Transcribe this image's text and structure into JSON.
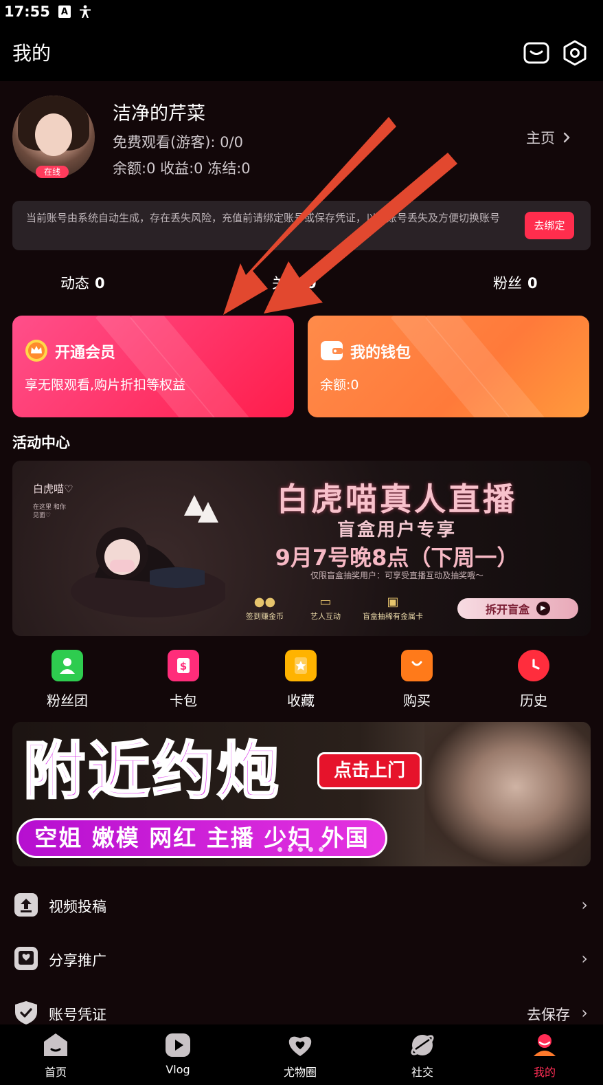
{
  "status_bar": {
    "time": "17:55",
    "icons": [
      "a-box-icon",
      "accessibility-icon"
    ]
  },
  "header": {
    "title": "我的",
    "icons": [
      "message-icon",
      "settings-icon"
    ]
  },
  "profile": {
    "online_badge": "在线",
    "nickname": "洁净的芹菜",
    "free_watch": "免费观看(游客): 0/0",
    "balances": "余额:0 收益:0 冻结:0",
    "homepage_link": "主页"
  },
  "notice": {
    "text": "当前账号由系统自动生成，存在丢失风险，充值前请绑定账号或保存凭证，以防账号丢失及方便切换账号",
    "button": "去绑定"
  },
  "stats": [
    {
      "label": "动态",
      "value": "0"
    },
    {
      "label": "关注",
      "value": "0"
    },
    {
      "label": "粉丝",
      "value": "0"
    }
  ],
  "cards": {
    "vip": {
      "title": "开通会员",
      "subtitle": "享无限观看,购片折扣等权益"
    },
    "wallet": {
      "title": "我的钱包",
      "subtitle": "余额:0"
    }
  },
  "section_title": "活动中心",
  "event_banner": {
    "corner_text": "白虎喵♡",
    "corner_sub": "在这里 和你见面♡",
    "title": "白虎喵真人直播",
    "subtitle": "盲盒用户专享",
    "date": "9月7号晚8点（下周一）",
    "note": "仅限盲盒抽奖用户：可享受直播互动及抽奖哦～",
    "features": [
      "签到赚金币",
      "艺人互动",
      "盲盒抽稀有金属卡"
    ],
    "button": "拆开盲盒"
  },
  "quick_menu": [
    {
      "label": "粉丝团",
      "icon": "fan-club-icon",
      "color": "#2ecc4f"
    },
    {
      "label": "卡包",
      "icon": "card-wallet-icon",
      "color": "#ff2d7a"
    },
    {
      "label": "收藏",
      "icon": "favorite-icon",
      "color": "#ffb300"
    },
    {
      "label": "购买",
      "icon": "purchase-icon",
      "color": "#ff7a1a"
    },
    {
      "label": "历史",
      "icon": "history-icon",
      "color": "#ff2d3d"
    }
  ],
  "ad_banner": {
    "headline": "附近约炮",
    "cta": "点击上门",
    "strip": "空姐 嫩模 网红 主播 少妇 外国"
  },
  "menu": [
    {
      "label": "视频投稿",
      "icon": "upload-icon",
      "value": ""
    },
    {
      "label": "分享推广",
      "icon": "share-icon",
      "value": ""
    },
    {
      "label": "账号凭证",
      "icon": "shield-icon",
      "value": "去保存"
    }
  ],
  "tabs": [
    {
      "label": "首页",
      "icon": "home-icon"
    },
    {
      "label": "Vlog",
      "icon": "play-icon"
    },
    {
      "label": "尤物圈",
      "icon": "heart-chat-icon"
    },
    {
      "label": "社交",
      "icon": "planet-icon"
    },
    {
      "label": "我的",
      "icon": "profile-icon",
      "active": true
    }
  ],
  "colors": {
    "accent": "#ff2d55",
    "background": "#120709",
    "vip_card": "#ff3468",
    "wallet_card": "#ff7a3a",
    "annotation_arrow": "#e2482f"
  }
}
